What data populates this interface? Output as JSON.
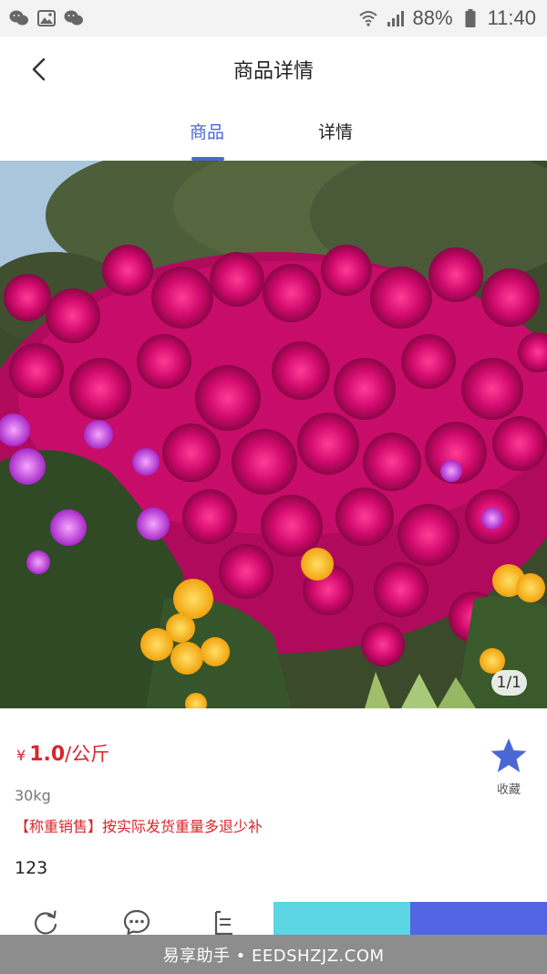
{
  "status_bar": {
    "left_icons": [
      "wechat-icon",
      "image-icon",
      "wechat-icon"
    ],
    "battery_percent": "88%",
    "time": "11:40"
  },
  "header": {
    "title": "商品详情",
    "back_icon": "chevron-left-icon"
  },
  "tabs": [
    {
      "label": "商品",
      "active": true
    },
    {
      "label": "详情",
      "active": false
    }
  ],
  "gallery": {
    "counter": "1/1"
  },
  "product": {
    "currency_symbol": "¥",
    "price": "1.0",
    "unit": "/公斤",
    "favorite_label": "收藏",
    "weight": "30kg",
    "notice": "【称重销售】按实际发货重量多退少补",
    "description": "123"
  },
  "action_bar": {
    "icons": [
      "refresh-icon",
      "chat-icon",
      "list-icon"
    ]
  },
  "watermark": {
    "text": "易享助手 • EEDSHZJZ.COM"
  },
  "colors": {
    "accent": "#4a67d6",
    "price": "#d8262c",
    "cart_button": "#5bd6e2",
    "buy_button": "#5266e4",
    "favorite_star": "#4a67d6"
  }
}
